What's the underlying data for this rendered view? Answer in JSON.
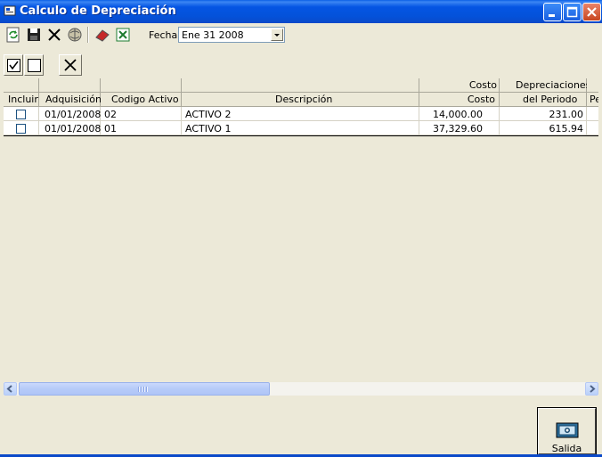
{
  "window": {
    "title": "Calculo de Depreciación"
  },
  "toolbar": {
    "tools": [
      "refresh-icon",
      "save-icon",
      "delete-icon",
      "process-icon",
      "eraser-icon",
      "excel-icon"
    ],
    "fecha_label": "Fecha",
    "fecha_value": "Ene  31  2008"
  },
  "selection_toolbar": [
    "check-all-icon",
    "uncheck-all-icon",
    "clear-icon"
  ],
  "grid": {
    "group_headers": {
      "costo": "Costo",
      "depreciaciones": "Depreciaciones"
    },
    "columns": [
      "Incluir",
      "Adquisición",
      "Codigo Activo",
      "Descripción",
      "Costo",
      "del Periodo",
      "Pe"
    ],
    "rows": [
      {
        "incluir": false,
        "adquisicion": "01/01/2008",
        "codigo": "02",
        "descripcion": "ACTIVO 2",
        "costo": "14,000.00",
        "periodo": "231.00"
      },
      {
        "incluir": false,
        "adquisicion": "01/01/2008",
        "codigo": "01",
        "descripcion": "ACTIVO 1",
        "costo": "37,329.60",
        "periodo": "615.94"
      }
    ]
  },
  "salida_label": "Salida",
  "colors": {
    "titlebar": "#0452DA",
    "face": "#ECE9D8"
  }
}
